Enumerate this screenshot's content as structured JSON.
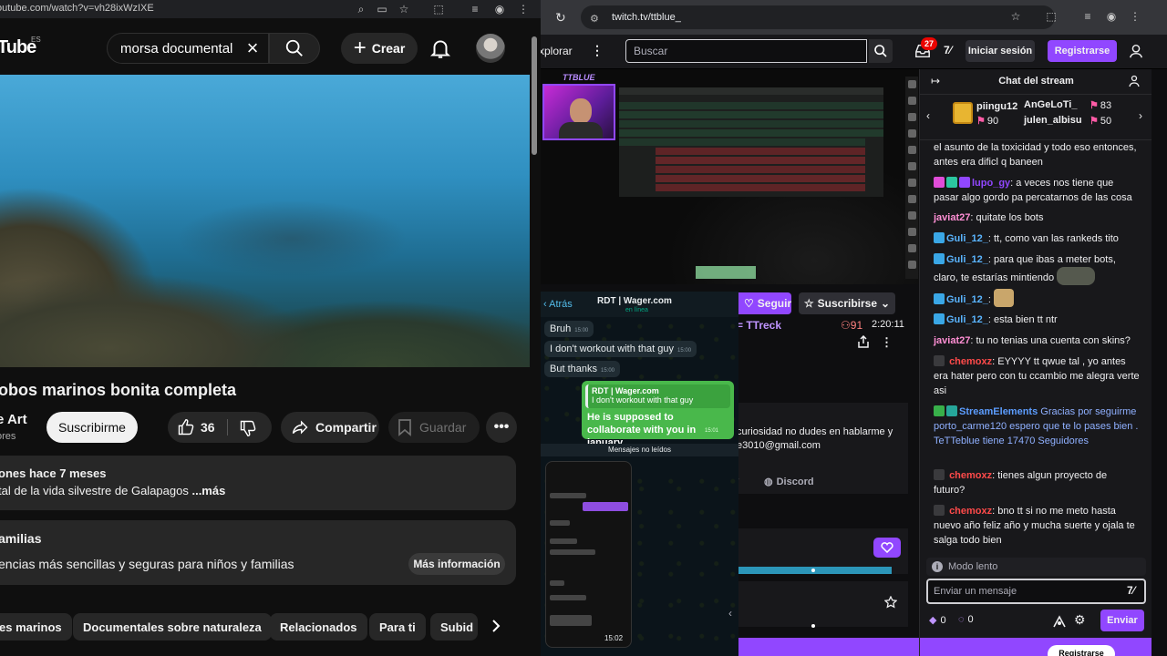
{
  "youtube": {
    "url": "outube.com/watch?v=vh28ixWzIXE",
    "logo": "Tube",
    "logo_region": "ES",
    "search_value": "morsa documental",
    "create_label": "Crear",
    "video_title": "obos marinos bonita completa",
    "channel_name": "e Art",
    "channel_sub": "ores",
    "subscribe_label": "Suscribirme",
    "like_count": "36",
    "share_label": "Compartir",
    "save_label": "Guardar",
    "desc_meta": "ones  hace 7 meses",
    "desc_text": "tal de la vida silvestre de Galapagos ",
    "desc_more": "...más",
    "info_title": "amilias",
    "info_text": "encias más sencillas y seguras para niños y familias",
    "info_button": "Más información",
    "chips": [
      "es marinos",
      "Documentales sobre naturaleza",
      "Relacionados",
      "Para ti",
      "Subid"
    ]
  },
  "twitch": {
    "url": "twitch.tv/ttblue_",
    "explore": "xplorar",
    "search_placeholder": "Buscar",
    "inbox_count": "27",
    "login_label": "Iniciar sesión",
    "signup_label": "Registrarse",
    "stream_brand": "TTBLUE",
    "whatsapp": {
      "back": "Atrás",
      "contact": "RDT | Wager.com",
      "status": "en línea",
      "messages": [
        {
          "text": "Bruh",
          "time": "15:00"
        },
        {
          "text": "I don't workout with that guy",
          "time": "15:00"
        },
        {
          "text": "But thanks",
          "time": "15:00"
        }
      ],
      "reply_quote_name": "RDT | Wager.com",
      "reply_quote_text": "I don't workout with that guy",
      "reply_text": "He is supposed to collaborate with you in january",
      "reply_time": "15:01",
      "unread_label": "Mensajes no leídos",
      "phone_time": "15:02"
    },
    "follow_label": "Seguir",
    "subscribe_label": "Suscribirse",
    "game": "= TTreck",
    "viewers": "91",
    "uptime": "2:20:11",
    "about_text": "curiosidad no dudes en hablarme y e3010@gmail.com",
    "discord_r": "r",
    "discord_label": "Discord",
    "chat": {
      "title": "Chat del stream",
      "gifters": [
        {
          "name": "piingu12",
          "count": "90"
        },
        {
          "name": "AnGeLoTi_",
          "count": "83"
        },
        {
          "name": "julen_albisu",
          "count": "50"
        }
      ],
      "messages": [
        {
          "user": "",
          "color": "#efeff1",
          "text": "el asunto de la toxicidad y todo eso entonces, antes era dificl q baneen"
        },
        {
          "user": "lupo_gy",
          "color": "#9147ff",
          "text": ": a veces nos tiene que pasar algo gordo pa percatarnos de las cosa"
        },
        {
          "user": "javiat27",
          "color": "#ff8fd4",
          "text": ": quitate los bots"
        },
        {
          "user": "Guli_12_",
          "color": "#5ab5ff",
          "text": ": tt, como van las rankeds tito"
        },
        {
          "user": "Guli_12_",
          "color": "#5ab5ff",
          "text": ": para que ibas a meter bots, claro, te estarías mintiendo"
        },
        {
          "user": "Guli_12_",
          "color": "#5ab5ff",
          "text": ":"
        },
        {
          "user": "Guli_12_",
          "color": "#5ab5ff",
          "text": ": esta bien tt ntr"
        },
        {
          "user": "javiat27",
          "color": "#ff8fd4",
          "text": ": tu no tenias una cuenta con skins?"
        },
        {
          "user": "chemoxz",
          "color": "#ff4a4a",
          "text": ": EYYYY tt qwue tal , yo antes era hater pero con tu ccambio me alegra verte asi"
        },
        {
          "user": "StreamElements",
          "color": "#5c9dff",
          "text": " Gracias por seguirme porto_carme120  espero que te lo pases bien . TeTTeblue tiene 17470 Seguidores"
        },
        {
          "user": "chemoxz",
          "color": "#ff4a4a",
          "text": ": tienes algun proyecto de futuro?"
        },
        {
          "user": "chemoxz",
          "color": "#ff4a4a",
          "text": ": bno tt si no me meto hasta nuevo año feliz año y mucha suerte y ojala te salga todo bien"
        }
      ],
      "slow_mode": "Modo lento",
      "input_placeholder": "Enviar un mensaje",
      "bits": "0",
      "points": "0",
      "send_label": "Enviar",
      "bottom_button": "Registrarse"
    }
  }
}
